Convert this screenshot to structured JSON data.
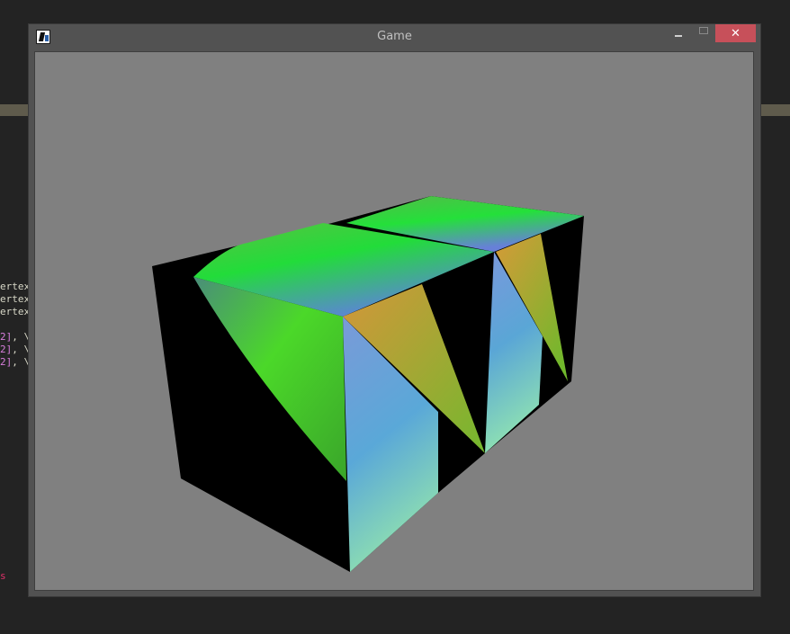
{
  "background_editor": {
    "code_lines": [
      {
        "pre": "ertex",
        "num": "",
        "post": ""
      },
      {
        "pre": "ertex",
        "num": "",
        "post": ""
      },
      {
        "pre": "ertex",
        "num": "",
        "post": ""
      },
      {
        "pre": "",
        "num": "",
        "post": ""
      },
      {
        "pre": "",
        "num": "2]",
        "post": ", \\"
      },
      {
        "pre": "",
        "num": "2]",
        "post": ", \\"
      },
      {
        "pre": "",
        "num": "2]",
        "post": ", \\"
      }
    ],
    "stray_char": "s"
  },
  "window": {
    "title": "Game",
    "close_label": "✕"
  },
  "scene": {
    "background_color": "#808080",
    "shape_color": "#000000",
    "gradient_colors": [
      "#3ddc2a",
      "#6a8fd6",
      "#d49a30",
      "#8fe0b8",
      "#20d840"
    ]
  }
}
